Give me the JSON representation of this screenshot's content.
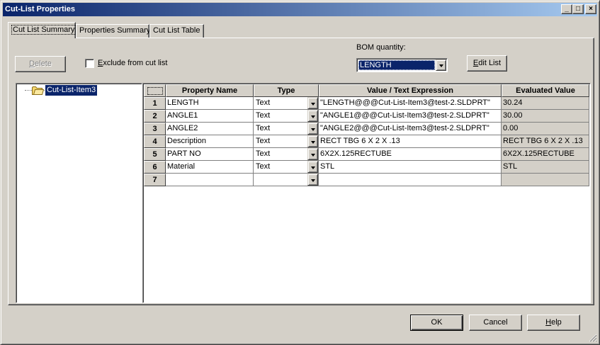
{
  "window": {
    "title": "Cut-List Properties",
    "minimize_glyph": "_",
    "maximize_glyph": "□",
    "close_glyph": "×"
  },
  "tabs": [
    {
      "label": "Cut List Summary",
      "active": true
    },
    {
      "label": "Properties Summary",
      "active": false
    },
    {
      "label": "Cut List Table",
      "active": false
    }
  ],
  "toolbar": {
    "delete_label": "Delete",
    "delete_mnemonic": "D",
    "delete_rest": "elete",
    "exclude_label_mnemonic": "E",
    "exclude_label_rest": "xclude from cut list",
    "exclude_checked": false,
    "bom_label": "BOM quantity:",
    "bom_value": "LENGTH",
    "edit_list_mnemonic": "E",
    "edit_list_rest": "dit List"
  },
  "tree": {
    "items": [
      {
        "label": "Cut-List-Item3",
        "selected": true
      }
    ]
  },
  "grid": {
    "headers": {
      "property": "Property Name",
      "type": "Type",
      "value": "Value / Text Expression",
      "evaluated": "Evaluated Value"
    },
    "rows": [
      {
        "num": "1",
        "property": "LENGTH",
        "type": "Text",
        "value": "\"LENGTH@@@Cut-List-Item3@test-2.SLDPRT\"",
        "evaluated": "30.24"
      },
      {
        "num": "2",
        "property": "ANGLE1",
        "type": "Text",
        "value": "\"ANGLE1@@@Cut-List-Item3@test-2.SLDPRT\"",
        "evaluated": "30.00"
      },
      {
        "num": "3",
        "property": "ANGLE2",
        "type": "Text",
        "value": "\"ANGLE2@@@Cut-List-Item3@test-2.SLDPRT\"",
        "evaluated": "0.00"
      },
      {
        "num": "4",
        "property": "Description",
        "type": "Text",
        "value": "RECT TBG 6 X 2 X .13",
        "evaluated": "RECT TBG 6 X 2 X .13"
      },
      {
        "num": "5",
        "property": "PART NO",
        "type": "Text",
        "value": "6X2X.125RECTUBE",
        "evaluated": "6X2X.125RECTUBE"
      },
      {
        "num": "6",
        "property": "Material",
        "type": "Text",
        "value": "STL",
        "evaluated": "STL"
      },
      {
        "num": "7",
        "property": "",
        "type": "",
        "value": "",
        "evaluated": ""
      }
    ]
  },
  "footer": {
    "ok_label": "OK",
    "cancel_label": "Cancel",
    "help_mnemonic": "H",
    "help_rest": "elp"
  },
  "colors": {
    "titlebar_start": "#0a246a",
    "titlebar_end": "#a6caf0",
    "face": "#d4d0c8",
    "selection": "#0a246a",
    "folder": "#f5d76e"
  }
}
